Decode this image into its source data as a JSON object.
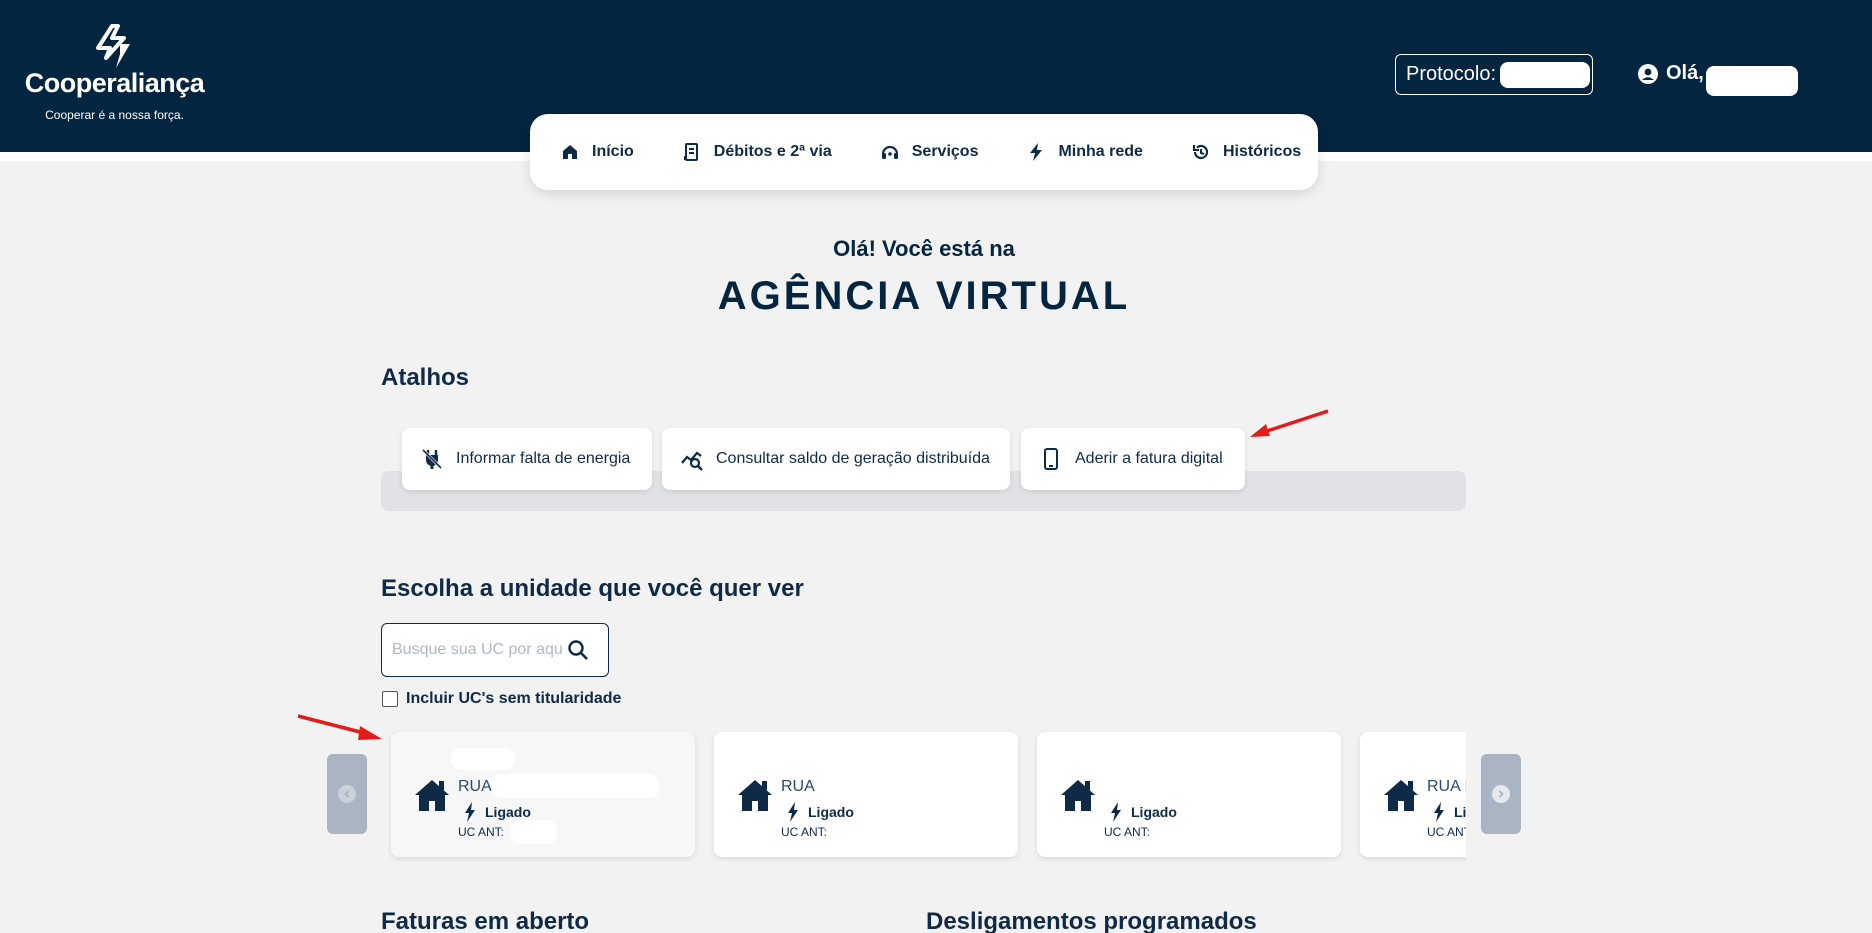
{
  "brand": {
    "name": "Cooperaliança",
    "slogan": "Cooperar é a nossa força."
  },
  "header": {
    "protocol_label": "Protocolo:",
    "greeting": "Olá,"
  },
  "nav": {
    "items": [
      {
        "label": "Início",
        "icon": "home-icon"
      },
      {
        "label": "Débitos e 2ª via",
        "icon": "receipt-icon"
      },
      {
        "label": "Serviços",
        "icon": "headset-icon"
      },
      {
        "label": "Minha rede",
        "icon": "bolt-icon"
      },
      {
        "label": "Históricos",
        "icon": "history-icon"
      }
    ]
  },
  "hero": {
    "subtitle": "Olá! Você está na",
    "title": "AGÊNCIA VIRTUAL"
  },
  "shortcuts": {
    "title": "Atalhos",
    "items": [
      {
        "label": "Informar falta de energia",
        "icon": "no-power-icon"
      },
      {
        "label": "Consultar saldo de geração distribuída",
        "icon": "chart-search-icon"
      },
      {
        "label": "Aderir a fatura digital",
        "icon": "smartphone-icon"
      }
    ]
  },
  "units": {
    "title": "Escolha a unidade que você quer ver",
    "search_placeholder": "Busque sua UC por aqui",
    "include_label": "Incluir UC's sem titularidade",
    "cards": [
      {
        "street": "RUA",
        "status": "Ligado",
        "uc_ant": "UC ANT:"
      },
      {
        "street": "RUA",
        "status": "Ligado",
        "uc_ant": "UC ANT:"
      },
      {
        "street": "",
        "status": "Ligado",
        "uc_ant": "UC ANT:"
      },
      {
        "street": "RUA I",
        "status": "Ligado",
        "uc_ant": "UC ANT:"
      }
    ]
  },
  "bottom": {
    "open_invoices": "Faturas em aberto",
    "scheduled_outages": "Desligamentos programados"
  },
  "colors": {
    "header_bg": "#042540",
    "text_primary": "#0f2a47",
    "annotation_arrow": "#e31b1b"
  }
}
